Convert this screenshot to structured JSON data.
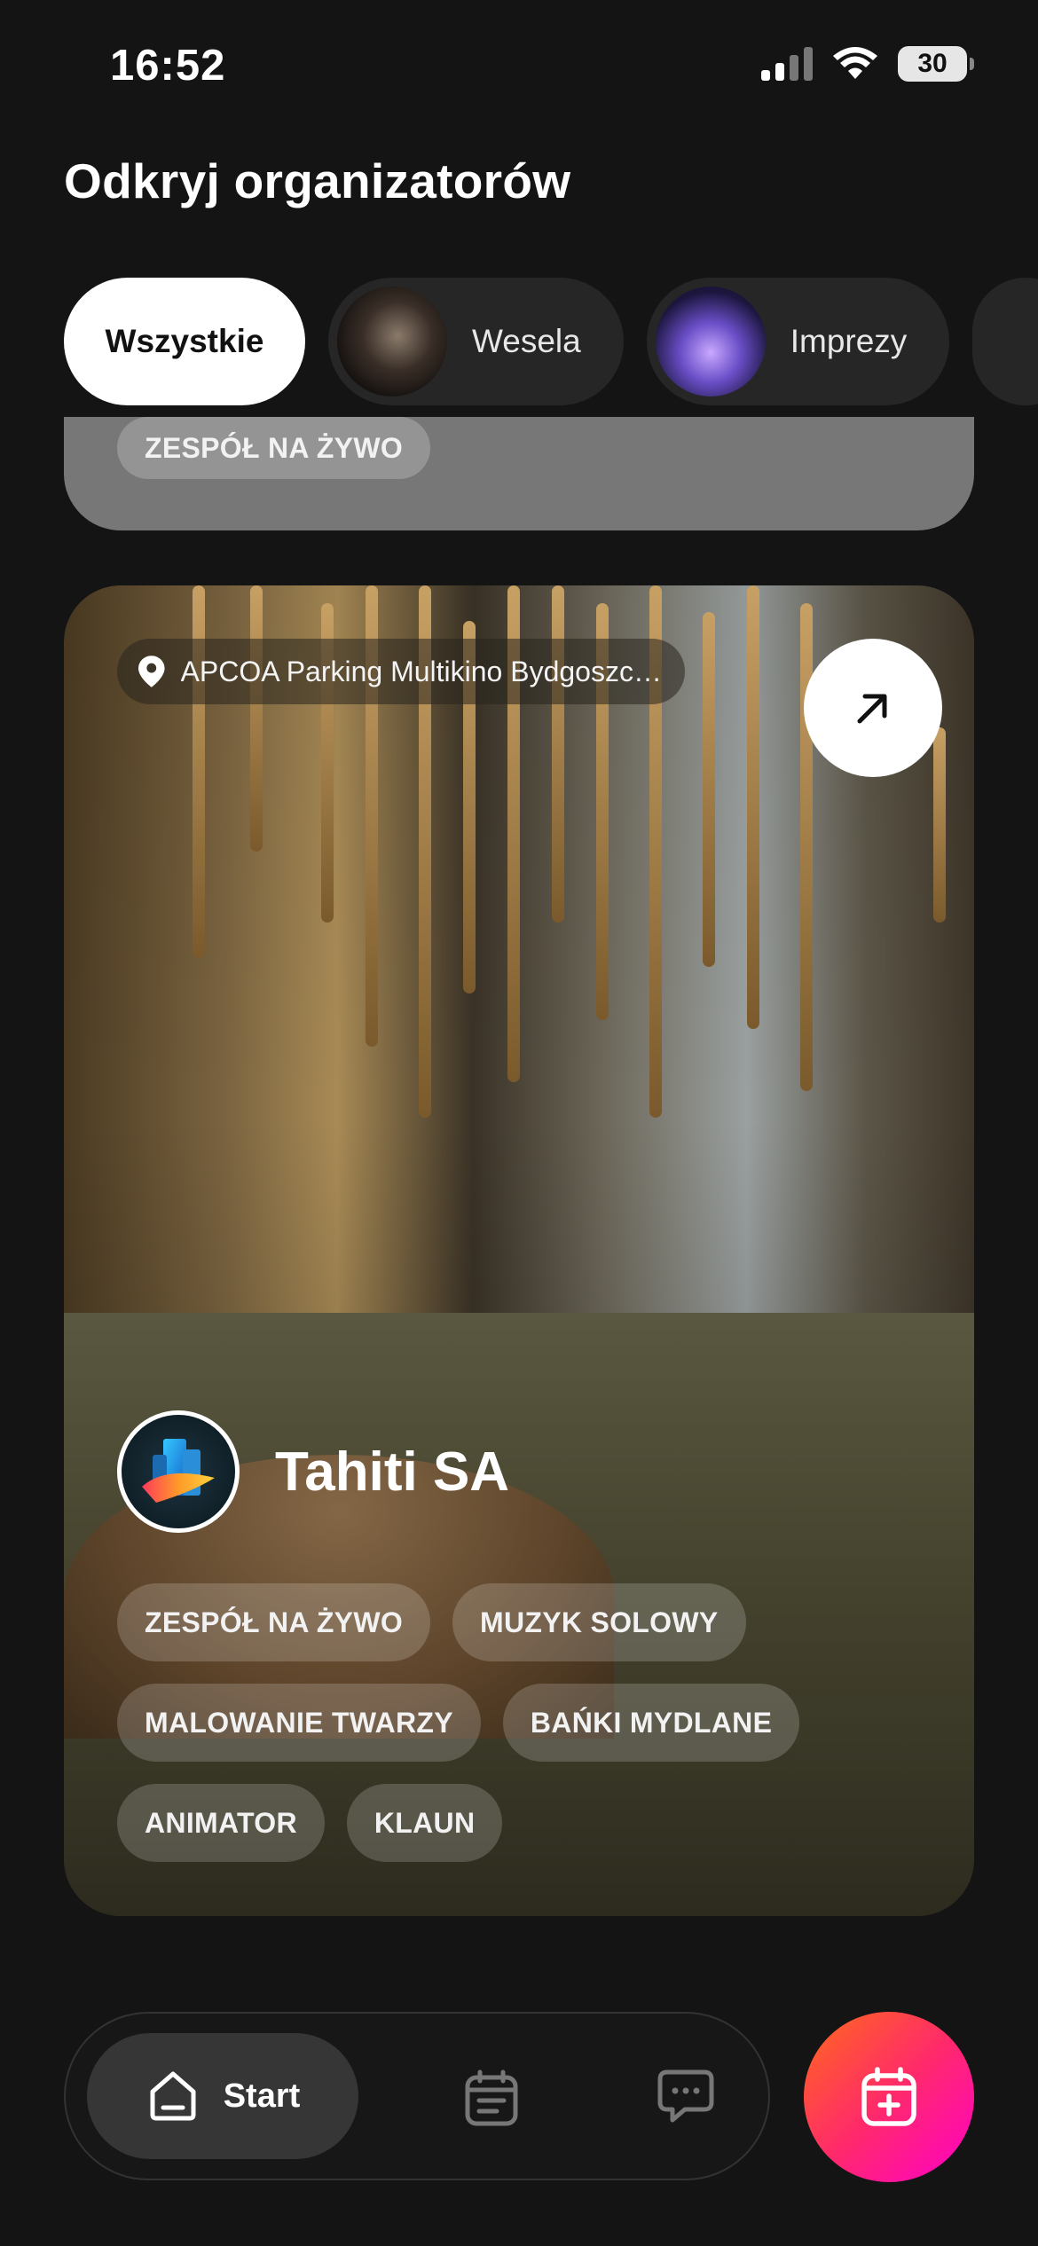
{
  "status_bar": {
    "time": "16:52",
    "battery": "30"
  },
  "header": {
    "title": "Odkryj organizatorów"
  },
  "categories": [
    {
      "label": "Wszystkie",
      "active": true
    },
    {
      "label": "Wesela",
      "active": false
    },
    {
      "label": "Imprezy",
      "active": false
    }
  ],
  "previous_card": {
    "tag": "ZESPÓŁ NA ŻYWO"
  },
  "organizer_card": {
    "location": "APCOA Parking Multikino Bydgoszcz...",
    "name": "Tahiti SA",
    "tags": [
      "ZESPÓŁ NA ŻYWO",
      "MUZYK SOLOWY",
      "MALOWANIE TWARZY",
      "BAŃKI MYDLANE",
      "ANIMATOR",
      "KLAUN"
    ]
  },
  "bottom_nav": {
    "start_label": "Start"
  },
  "colors": {
    "background": "#141414",
    "fab_gradient_start": "#ff6a1a",
    "fab_gradient_end": "#ff00c8"
  }
}
